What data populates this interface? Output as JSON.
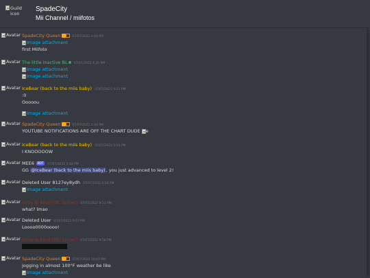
{
  "header": {
    "guild_icon_alt": "Guild icon",
    "guild_name": "SpadeCity",
    "channel_name": " Mii Channel / miifotos"
  },
  "colors": {
    "background": "#36393f",
    "link": "#00b0f4",
    "timestamp": "#72767d",
    "orange_author": "#e67e22",
    "green_author": "#2ecc71",
    "gold_author": "#f1c40f",
    "red_author": "#992d22",
    "white_author": "#dcddde",
    "bot_tag": "#5865f2"
  },
  "avatar_alt": "Avatar",
  "messages": [
    {
      "author": "SpadeCity Queen",
      "author_color": "#e67e22",
      "emoji": "crown-emoji",
      "timestamp": "07/07/2022 4:09 PM",
      "lines": [
        {
          "type": "attach",
          "text": "Image attachment"
        },
        {
          "type": "text",
          "text": "first Miifoto"
        }
      ]
    },
    {
      "author": "The little inactive BL",
      "author_color": "#2ecc71",
      "emoji": "green-dot-emoji",
      "timestamp": "07/07/2022 4:20 PM",
      "lines": [
        {
          "type": "attach",
          "text": "Image attachment"
        },
        {
          "type": "attach",
          "text": "Image attachment"
        }
      ]
    },
    {
      "author": "IceBear (back to the miis baby)",
      "author_color": "#f1c40f",
      "timestamp": "07/07/2022 4:21 PM",
      "lines": [
        {
          "type": "text",
          "text": ":0"
        },
        {
          "type": "text",
          "text": "Ooooou"
        },
        {
          "type": "spacer"
        },
        {
          "type": "attach",
          "text": "Image attachment"
        }
      ]
    },
    {
      "author": "SpadeCity Queen",
      "author_color": "#e67e22",
      "emoji": "crown-emoji",
      "timestamp": "07/07/2022 4:34 PM",
      "lines": [
        {
          "type": "text",
          "text": "YOUTUBE NOTIFICATIONS ARE OFF THE CHART DUDE",
          "img_after": "e"
        }
      ]
    },
    {
      "author": "IceBear (back to the miis baby)",
      "author_color": "#f1c40f",
      "timestamp": "07/07/2022 5:44 PM",
      "lines": [
        {
          "type": "text",
          "text": "I KNOOOOOW"
        }
      ]
    },
    {
      "author": "MEE6",
      "author_color": "#dcddde",
      "bot": "BOT",
      "timestamp": "07/07/2022 5:44 PM",
      "lines": [
        {
          "type": "mention",
          "pre": "GG ",
          "mention": "@IceBear (back to the miis baby)",
          "post": ", you just advanced to level 2!"
        }
      ]
    },
    {
      "author": "Deleted User 8127ey8ydh",
      "author_color": "#dcddde",
      "timestamp": "07/07/2022 6:59 PM",
      "lines": [
        {
          "type": "attach",
          "text": "Image attachment"
        }
      ]
    },
    {
      "author": "Kirby & Alice (IRL Spicer)",
      "author_color": "#992d22",
      "timestamp": "07/07/2022 9:51 PM",
      "lines": [
        {
          "type": "text",
          "text": "what? lmao"
        }
      ]
    },
    {
      "author": "Deleted User",
      "author_color": "#dcddde",
      "timestamp": "07/07/2022 9:57 PM",
      "lines": [
        {
          "type": "text",
          "text": "Loooo0000oooo!"
        }
      ]
    },
    {
      "author": "Kirby & Alice (IRL Spicer)",
      "author_color": "#992d22",
      "timestamp": "07/07/2022 9:58 PM",
      "lines": [
        {
          "type": "block"
        }
      ]
    },
    {
      "author": "SpadeCity Queen",
      "author_color": "#e67e22",
      "emoji": "crown-emoji",
      "timestamp": "07/07/2022 10:07 PM",
      "lines": [
        {
          "type": "text",
          "text": "jogging in almost 100°F weather be like"
        },
        {
          "type": "attach",
          "text": "Image attachment"
        }
      ]
    }
  ]
}
